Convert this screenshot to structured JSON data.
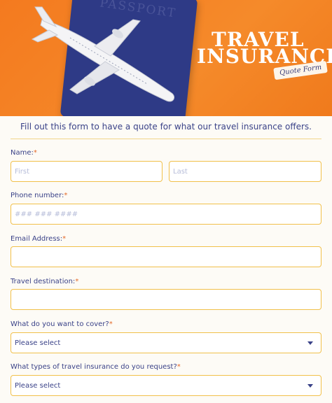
{
  "hero": {
    "passport_text": "PASSPORT",
    "title_line1": "TRAVEL",
    "title_line2": "INSURANCE",
    "badge": "Quote Form"
  },
  "intro": "Fill out this form to have a quote for what our travel insurance offers.",
  "form": {
    "name": {
      "label": "Name:",
      "first_placeholder": "First",
      "last_placeholder": "Last"
    },
    "phone": {
      "label": "Phone number:",
      "placeholder": "### ### ####"
    },
    "email": {
      "label": "Email Address:",
      "placeholder": ""
    },
    "destination": {
      "label": "Travel destination:",
      "placeholder": ""
    },
    "cover": {
      "label": "What do you want to cover?",
      "value": "Please select"
    },
    "types": {
      "label": "What types of travel insurance do you request?",
      "value": "Please select"
    },
    "required_mark": "*"
  },
  "colors": {
    "accent": "#f47a1f",
    "navy": "#3a4288",
    "field_border": "#f1c04a"
  }
}
